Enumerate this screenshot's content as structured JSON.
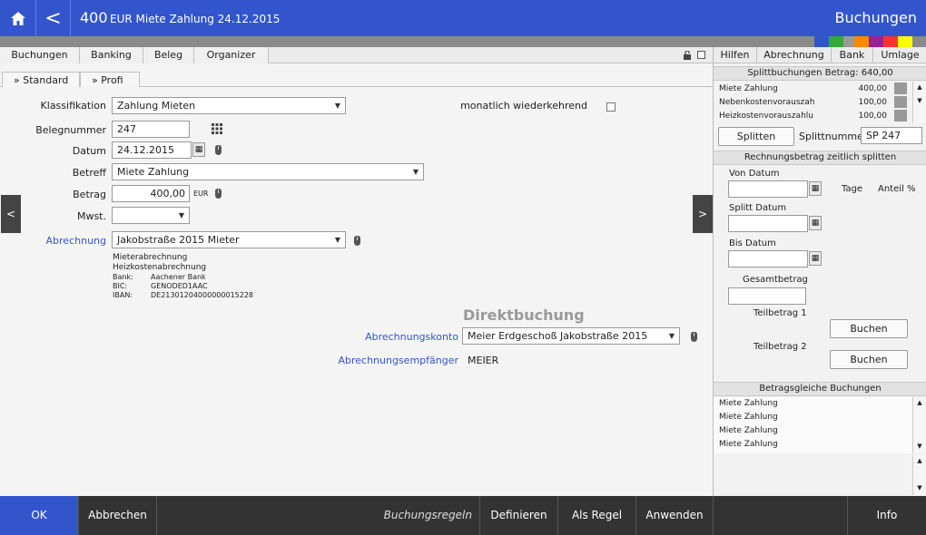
{
  "header": {
    "amount": "400",
    "description": "EUR Miete Zahlung 24.12.2015",
    "title": "Buchungen",
    "back_label": "<"
  },
  "colors": {
    "accent": "#3355cc",
    "swatches": [
      "#3355cc",
      "#33aa33",
      "#999999",
      "#ff8800",
      "#992299",
      "#ff3333",
      "#ffff00"
    ]
  },
  "tabs": [
    "Buchungen",
    "Banking",
    "Beleg",
    "Organizer"
  ],
  "subtabs": [
    "» Standard",
    "» Profi"
  ],
  "form": {
    "klassifikation_label": "Klassifikation",
    "klassifikation_value": "Zahlung Mieten",
    "monatlich_label": "monatlich wiederkehrend",
    "belegnummer_label": "Belegnummer",
    "belegnummer_value": "247",
    "datum_label": "Datum",
    "datum_value": "24.12.2015",
    "betreff_label": "Betreff",
    "betreff_value": "Miete Zahlung",
    "betrag_label": "Betrag",
    "betrag_value": "400,00",
    "betrag_currency": "EUR",
    "mwst_label": "Mwst.",
    "mwst_value": "",
    "abrechnung_label": "Abrechnung",
    "abrechnung_value": "Jakobstraße 2015 Mieter",
    "info_line1": "Mieterabrechnung",
    "info_line2": "Heizkostenabrechnung",
    "bank_label": "Bank:",
    "bank_value": "Aachener Bank",
    "bic_label": "BIC:",
    "bic_value": "GENODED1AAC",
    "iban_label": "IBAN:",
    "iban_value": "DE21301204000000015228",
    "direkt_title": "Direktbuchung",
    "konto_label": "Abrechnungskonto",
    "konto_value": "Meier Erdgeschoß Jakobstraße 2015",
    "empfaenger_label": "Abrechnungsempfänger",
    "empfaenger_value": "MEIER"
  },
  "nav": {
    "prev": "<",
    "next": ">"
  },
  "side": {
    "tabs": [
      "Hilfen",
      "Abrechnung",
      "Bank",
      "Umlage"
    ],
    "split_header": "Splittbuchungen Betrag: 640,00",
    "split_rows": [
      {
        "name": "Miete Zahlung",
        "amount": "400,00"
      },
      {
        "name": "Nebenkostenvorauszah",
        "amount": "100,00"
      },
      {
        "name": "Heizkostenvorauszahlu",
        "amount": "100,00"
      }
    ],
    "splitten_label": "Splitten",
    "splittnummer_label": "Splittnummer",
    "splittnummer_value": "SP 247",
    "zeitlich_header": "Rechnungsbetrag zeitlich splitten",
    "von_label": "Von Datum",
    "tage_label": "Tage",
    "anteil_label": "Anteil %",
    "splitt_datum_label": "Splitt Datum",
    "bis_label": "Bis Datum",
    "gesamt_label": "Gesamtbetrag",
    "teil1_label": "Teilbetrag 1",
    "teil2_label": "Teilbetrag 2",
    "buchen_label": "Buchen",
    "betragsgleiche_header": "Betragsgleiche Buchungen",
    "betragsgleiche": [
      "Miete Zahlung",
      "Miete Zahlung",
      "Miete Zahlung",
      "Miete Zahlung"
    ]
  },
  "footer": {
    "ok": "OK",
    "abbrechen": "Abbrechen",
    "buchungsregeln": "Buchungsregeln",
    "definieren": "Definieren",
    "als_regel": "Als Regel",
    "anwenden": "Anwenden",
    "info": "Info"
  }
}
